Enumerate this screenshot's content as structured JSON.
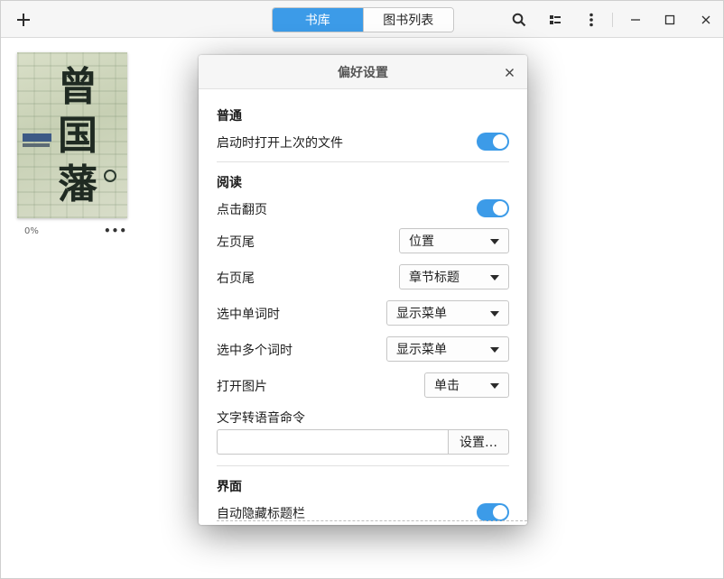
{
  "header": {
    "add_icon": "plus-icon",
    "tabs": [
      {
        "label": "书库",
        "active": true
      },
      {
        "label": "图书列表",
        "active": false
      }
    ],
    "search_icon": "search-icon",
    "view_icon": "view-mode-icon",
    "menu_icon": "kebab-menu-icon",
    "minimize_icon": "minimize-icon",
    "maximize_icon": "maximize-icon",
    "close_icon": "close-icon"
  },
  "library": {
    "books": [
      {
        "cover_text": "曾国藩",
        "progress": "0%",
        "menu": "•••"
      }
    ]
  },
  "dialog": {
    "title": "偏好设置",
    "sections": {
      "general": {
        "title": "普通",
        "open_last_file": {
          "label": "启动时打开上次的文件",
          "on": true
        }
      },
      "reading": {
        "title": "阅读",
        "click_turn_page": {
          "label": "点击翻页",
          "on": true
        },
        "left_footer": {
          "label": "左页尾",
          "value": "位置"
        },
        "right_footer": {
          "label": "右页尾",
          "value": "章节标题"
        },
        "select_word": {
          "label": "选中单词时",
          "value": "显示菜单"
        },
        "select_words": {
          "label": "选中多个词时",
          "value": "显示菜单"
        },
        "open_image": {
          "label": "打开图片",
          "value": "单击"
        },
        "tts": {
          "label": "文字转语音命令",
          "value": "",
          "button": "设置…"
        }
      },
      "interface": {
        "title": "界面",
        "auto_hide_titlebar": {
          "label": "自动隐藏标题栏",
          "on": true
        }
      }
    }
  },
  "colors": {
    "accent": "#3c9be8"
  }
}
